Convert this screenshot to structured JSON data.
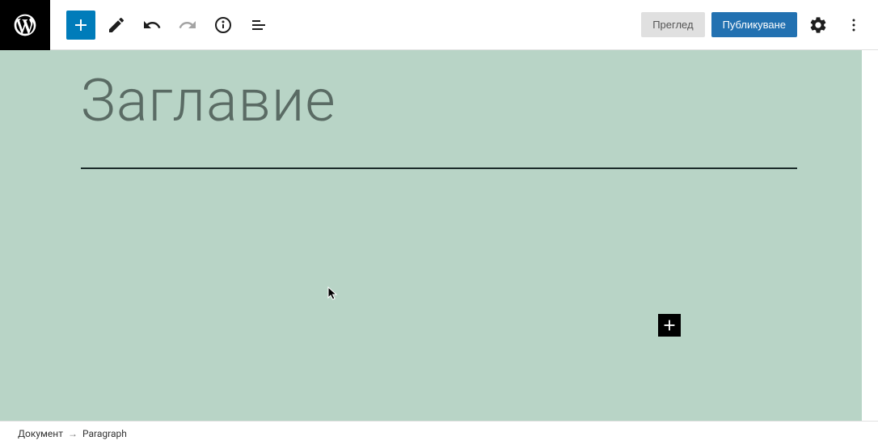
{
  "toolbar": {
    "preview_label": "Преглед",
    "publish_label": "Публикуване"
  },
  "editor": {
    "title_placeholder": "Заглавие"
  },
  "breadcrumb": {
    "root": "Документ",
    "current": "Paragraph"
  }
}
